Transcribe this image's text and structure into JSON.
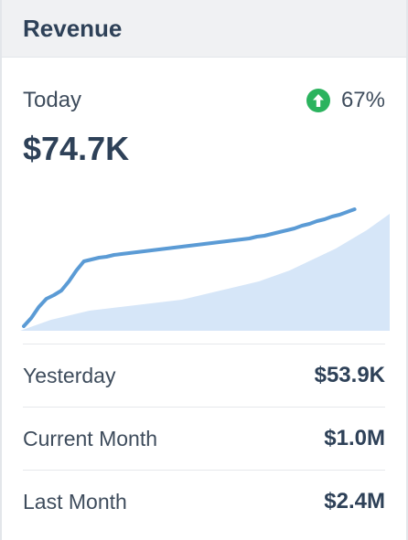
{
  "header": {
    "title": "Revenue"
  },
  "today": {
    "label": "Today",
    "value": "$74.7K",
    "change": "67%",
    "change_direction": "up",
    "change_icon": "arrow-up-circle-icon",
    "change_color": "#2bb35e"
  },
  "chart_data": {
    "type": "area",
    "title": "",
    "xlabel": "",
    "ylabel": "",
    "grid": false,
    "series": [
      {
        "role": "line",
        "color": "#5b9bd5",
        "values": [
          5,
          14,
          26,
          35,
          39,
          44,
          54,
          66,
          76,
          78,
          80,
          81,
          83,
          84,
          85,
          86,
          87,
          88,
          89,
          90,
          91,
          92,
          93,
          94,
          95,
          96,
          97,
          98,
          99,
          100,
          101,
          103,
          104,
          106,
          108,
          110,
          112,
          115,
          117,
          120,
          122,
          125,
          127,
          130,
          133
        ]
      },
      {
        "role": "area",
        "color": "#d6e6f8",
        "values": [
          0,
          3,
          6,
          9,
          12,
          14,
          16,
          18,
          20,
          22,
          23,
          24,
          25,
          26,
          27,
          28,
          29,
          30,
          31,
          32,
          33,
          34,
          36,
          38,
          40,
          42,
          44,
          46,
          48,
          50,
          52,
          54,
          57,
          60,
          63,
          66,
          70,
          74,
          78,
          82,
          86,
          90,
          95,
          100,
          105,
          110,
          116,
          122,
          128
        ]
      }
    ]
  },
  "stats": [
    {
      "label": "Yesterday",
      "value": "$53.9K"
    },
    {
      "label": "Current Month",
      "value": "$1.0M"
    },
    {
      "label": "Last Month",
      "value": "$2.4M"
    }
  ]
}
